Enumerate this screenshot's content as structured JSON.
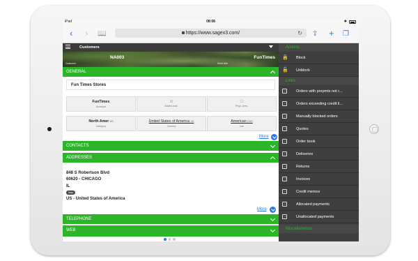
{
  "statusbar": {
    "device": "iPad",
    "time": "08:08",
    "bluetooth": "✱",
    "battery_level": 0.8
  },
  "browser": {
    "url": "https://www.sagex3.com/",
    "icons": [
      "back-icon",
      "forward-icon",
      "bookmarks-icon",
      "reload-icon",
      "share-icon",
      "new-tab-icon",
      "tabs-icon"
    ]
  },
  "app": {
    "title": "Customers"
  },
  "banner": {
    "customer_label": "Customer",
    "code": "NA003",
    "short_title_label": "Short title",
    "short_title": "FunTimes"
  },
  "sections": {
    "general": "GENERAL",
    "contacts": "CONTACTS",
    "addresses": "ADDRESSES",
    "telephone": "TELEPHONE",
    "web": "WEB"
  },
  "general": {
    "company_name": "Fun Times Stores",
    "fields": [
      {
        "value": "FunTimes",
        "label": "Acronym"
      },
      {
        "value": "",
        "label": "Added cust."
      },
      {
        "value": "",
        "label": "Phys. pers."
      },
      {
        "value": "North Amer",
        "tag": "US",
        "label": "Category"
      },
      {
        "value": "United States of America",
        "tag": "US",
        "label": "Country"
      },
      {
        "value": "American",
        "tag": "ENG",
        "label": "Lan"
      }
    ]
  },
  "more_label": "More",
  "address": {
    "street": "848 S Robertson Blvd",
    "city": "60620 - CHICAGO",
    "state": "IL",
    "map_label": "Map",
    "country": "US - United States of America"
  },
  "pager": {
    "pages": 3,
    "active": 1
  },
  "panel": {
    "actions_title": "Actions",
    "actions": [
      {
        "label": "Block",
        "icon": "lock-icon"
      },
      {
        "label": "Unblock",
        "icon": "unlock-icon"
      }
    ],
    "links_title": "Links",
    "links": [
      "Orders with prepmts not r...",
      "Orders exceeding credit li...",
      "Manually blocked orders",
      "Quotes",
      "Order book",
      "Deliveries",
      "Returns",
      "Invoices",
      "Credit memos",
      "Allocated payments",
      "Unallocated payments"
    ],
    "misc_title": "Miscellaneous"
  },
  "colors": {
    "accent_green": "#2db52a",
    "link_blue": "#2a7ae2",
    "panel_bg": "#3f3f3f"
  }
}
